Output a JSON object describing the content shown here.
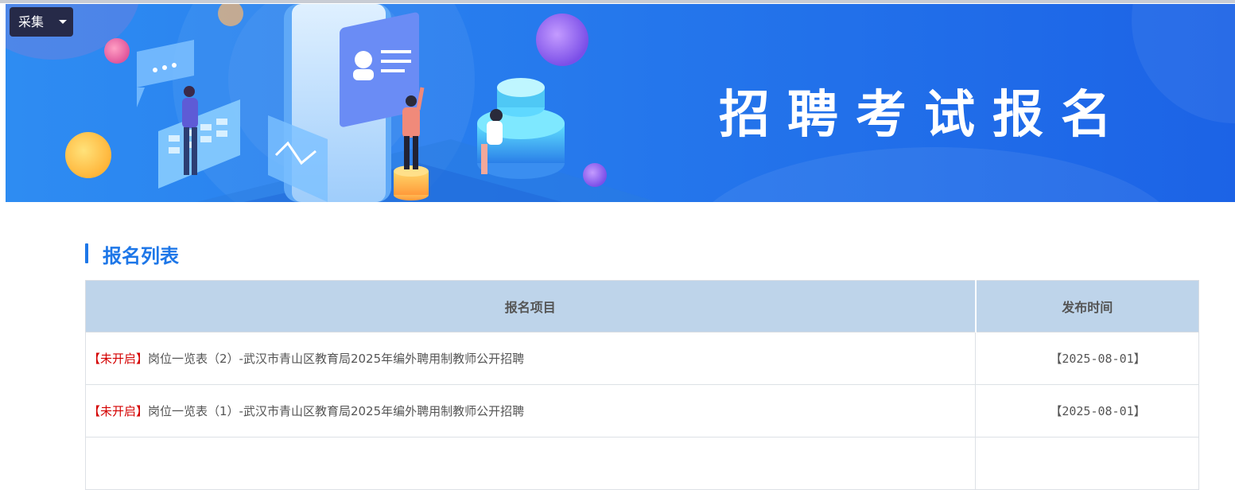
{
  "toolbar": {
    "collect_label": "采集"
  },
  "banner": {
    "title": "招聘考试报名",
    "colors": {
      "bg_left": "#2f88f0",
      "bg_right": "#1b5fe6"
    }
  },
  "section": {
    "title": "报名列表",
    "accent": "#1e77e8"
  },
  "table": {
    "headers": {
      "item": "报名项目",
      "date": "发布时间"
    },
    "header_bg": "#bed4ea",
    "status_color": "#d40000",
    "rows": [
      {
        "status": "【未开启】",
        "title": "岗位一览表（2）-武汉市青山区教育局2025年编外聘用制教师公开招聘",
        "date": "【2025-08-01】"
      },
      {
        "status": "【未开启】",
        "title": "岗位一览表（1）-武汉市青山区教育局2025年编外聘用制教师公开招聘",
        "date": "【2025-08-01】"
      },
      {
        "status": "",
        "title": "",
        "date": ""
      }
    ]
  }
}
